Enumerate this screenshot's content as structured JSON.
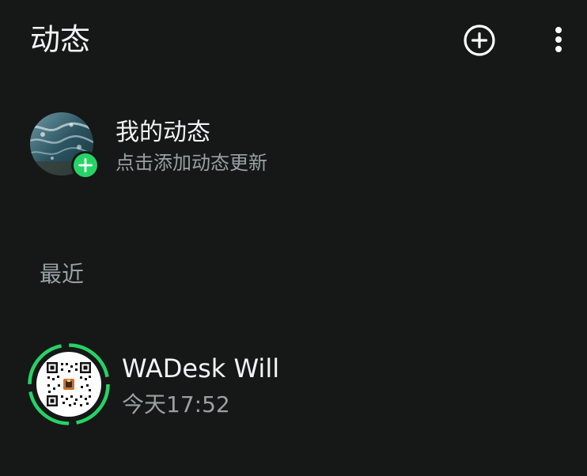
{
  "header": {
    "title": "动态",
    "add_icon": "plus-circle-icon",
    "menu_icon": "more-vertical-icon"
  },
  "my_status": {
    "title": "我的动态",
    "subtitle": "点击添加动态更新",
    "badge_icon": "plus-icon"
  },
  "recent": {
    "label": "最近",
    "items": [
      {
        "name": "WADesk Will",
        "time": "今天17:52",
        "avatar": "qr-code-image"
      }
    ]
  },
  "colors": {
    "background": "#161717",
    "accent": "#25d366",
    "text_primary": "#f2f4f5",
    "text_secondary": "#9aa0a3"
  }
}
